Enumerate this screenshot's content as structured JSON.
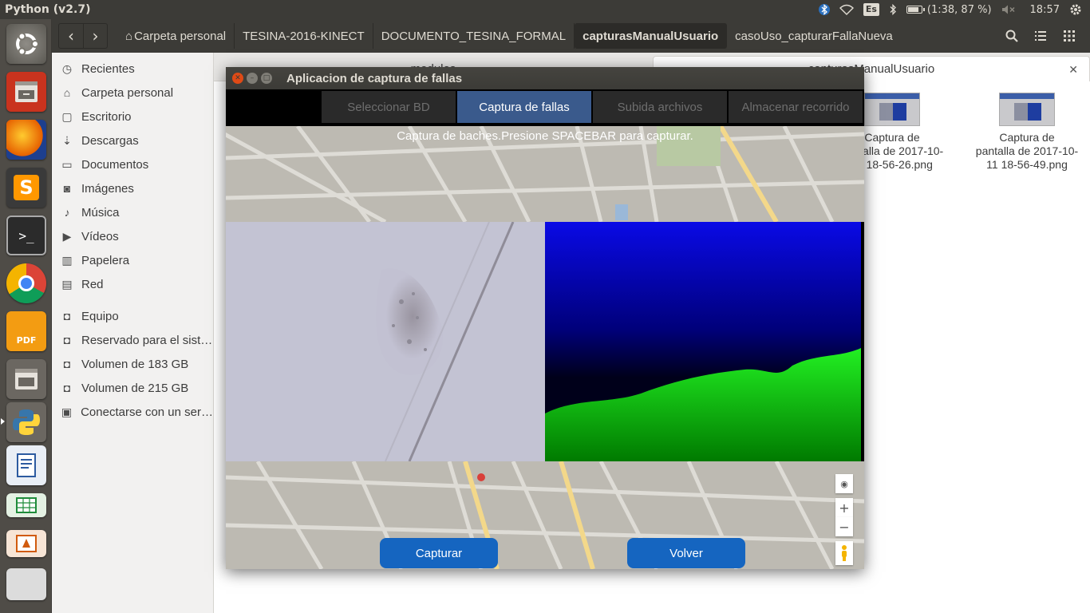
{
  "top_panel": {
    "app_title": "Python (v2.7)",
    "keyboard_layout": "Es",
    "battery_text": "(1:38, 87 %)",
    "clock": "18:57"
  },
  "launcher": {
    "items": [
      {
        "icon": "ubuntu-dash-icon"
      },
      {
        "icon": "files-icon"
      },
      {
        "icon": "firefox-icon"
      },
      {
        "icon": "sublime-text-icon",
        "glyph": "S"
      },
      {
        "icon": "terminal-icon",
        "glyph": ">_"
      },
      {
        "icon": "chrome-icon"
      },
      {
        "icon": "foxit-pdf-icon",
        "glyph": "PDF"
      },
      {
        "icon": "files-icon"
      },
      {
        "icon": "python-icon"
      },
      {
        "icon": "libreoffice-writer-icon"
      },
      {
        "icon": "libreoffice-calc-icon"
      },
      {
        "icon": "libreoffice-impress-icon"
      }
    ]
  },
  "file_manager": {
    "breadcrumbs": [
      {
        "label": "Carpeta personal",
        "icon": "home-icon"
      },
      {
        "label": "TESINA-2016-KINECT"
      },
      {
        "label": "DOCUMENTO_TESINA_FORMAL"
      },
      {
        "label": "capturasManualUsuario",
        "active": true
      },
      {
        "label": "casoUso_capturarFallaNueva"
      }
    ],
    "sidebar": {
      "places": [
        {
          "label": "Recientes",
          "icon": "clock-icon",
          "glyph": "◷"
        },
        {
          "label": "Carpeta personal",
          "icon": "home-icon",
          "glyph": "⌂"
        },
        {
          "label": "Escritorio",
          "icon": "desktop-icon",
          "glyph": "▢"
        },
        {
          "label": "Descargas",
          "icon": "download-icon",
          "glyph": "⇣"
        },
        {
          "label": "Documentos",
          "icon": "document-icon",
          "glyph": "▭"
        },
        {
          "label": "Imágenes",
          "icon": "camera-icon",
          "glyph": "◙"
        },
        {
          "label": "Música",
          "icon": "music-icon",
          "glyph": "♪"
        },
        {
          "label": "Vídeos",
          "icon": "video-icon",
          "glyph": "▶"
        },
        {
          "label": "Papelera",
          "icon": "trash-icon",
          "glyph": "▥"
        },
        {
          "label": "Red",
          "icon": "network-icon",
          "glyph": "▤"
        }
      ],
      "devices": [
        {
          "label": "Equipo",
          "icon": "drive-icon",
          "glyph": "◘"
        },
        {
          "label": "Reservado para el sist…",
          "icon": "drive-icon",
          "glyph": "◘"
        },
        {
          "label": "Volumen de 183 GB",
          "icon": "drive-icon",
          "glyph": "◘"
        },
        {
          "label": "Volumen de 215 GB",
          "icon": "drive-icon",
          "glyph": "◘"
        },
        {
          "label": "Conectarse con un ser…",
          "icon": "server-icon",
          "glyph": "▣"
        }
      ]
    },
    "tabs": [
      {
        "label": "modulos"
      },
      {
        "label": "capturasManualUsuario",
        "active": true
      }
    ],
    "files": [
      {
        "name": "Captura de pantalla de 2017-10-11 18-56-26.png",
        "line1": "Captura de",
        "line2": "pantalla de 2017-10-",
        "line3": "11 18-56-26.png"
      },
      {
        "name": "Captura de pantalla de 2017-10-11 18-56-49.png",
        "line1": "Captura de",
        "line2": "pantalla de 2017-10-",
        "line3": "11 18-56-49.png"
      }
    ]
  },
  "app_window": {
    "title": "Aplicacion de captura de fallas",
    "tabs": [
      {
        "label": "Seleccionar BD"
      },
      {
        "label": "Captura de fallas",
        "active": true
      },
      {
        "label": "Subida archivos"
      },
      {
        "label": "Almacenar recorrido"
      }
    ],
    "instructions": "Captura de baches.Presione SPACEBAR para capturar.",
    "buttons": {
      "capture": "Capturar",
      "back": "Volver"
    },
    "colors": {
      "accent": "#1565c0",
      "active_tab": "#3a5a8c"
    }
  }
}
